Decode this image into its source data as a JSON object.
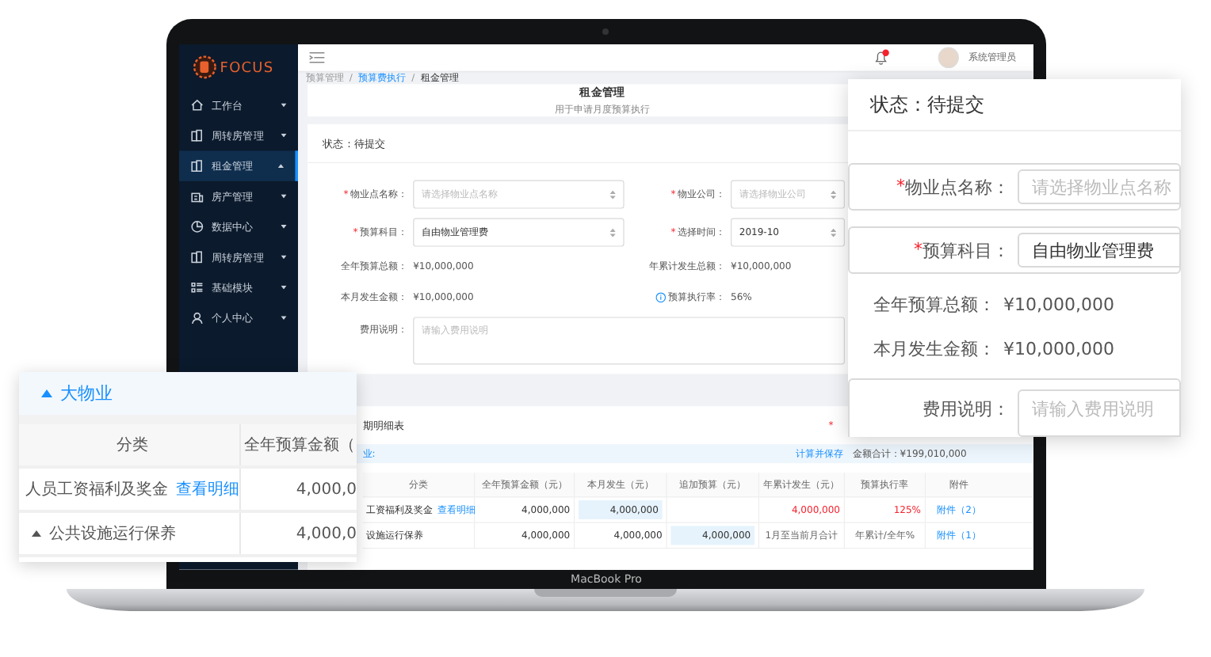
{
  "sidebar": {
    "logo": "FOCUS",
    "items": [
      {
        "label": "工作台",
        "selected": false,
        "expanded": false
      },
      {
        "label": "周转房管理",
        "selected": false,
        "expanded": false
      },
      {
        "label": "租金管理",
        "selected": true,
        "expanded": true
      },
      {
        "label": "房产管理",
        "selected": false,
        "expanded": false
      },
      {
        "label": "数据中心",
        "selected": false,
        "expanded": false
      },
      {
        "label": "周转房管理",
        "selected": false,
        "expanded": false
      },
      {
        "label": "基础模块",
        "selected": false,
        "expanded": false
      },
      {
        "label": "个人中心",
        "selected": false,
        "expanded": false
      }
    ]
  },
  "topbar": {
    "user": "系统管理员"
  },
  "breadcrumb": {
    "separator": "/",
    "items": [
      {
        "label": "预算管理",
        "kind": "parent"
      },
      {
        "label": "预算费执行",
        "kind": "link"
      },
      {
        "label": "租金管理",
        "kind": "current"
      }
    ]
  },
  "page_header": {
    "title": "租金管理",
    "subtitle": "用于申请月度预算执行"
  },
  "status": "状态：待提交",
  "form": {
    "fields": [
      {
        "kind": "select",
        "label": "物业点名称：",
        "required": true,
        "placeholder": "请选择物业点名称"
      },
      {
        "kind": "select",
        "label": "物业公司：",
        "required": true,
        "placeholder": "请选择物业公司"
      },
      {
        "kind": "select",
        "label": "预算科目：",
        "required": true,
        "value": "自由物业管理费"
      },
      {
        "kind": "select",
        "label": "选择时间：",
        "required": true,
        "value": "2019-10"
      },
      {
        "kind": "text",
        "label": "全年预算总额：",
        "required": false,
        "value": "¥10,000,000"
      },
      {
        "kind": "text",
        "label": "年累计发生总额：",
        "required": false,
        "value": "¥10,000,000"
      },
      {
        "kind": "text",
        "label": "本月发生金额：",
        "required": false,
        "value": "¥10,000,000"
      },
      {
        "kind": "info",
        "label": "预算执行率：",
        "required": false,
        "value": "56%"
      },
      {
        "kind": "textarea",
        "label": "费用说明：",
        "required": false,
        "placeholder": "请输入费用说明"
      }
    ]
  },
  "detail": {
    "title": "期明细表",
    "mark": "*",
    "group": "业:",
    "save_link": "计算并保存",
    "total": "金额合计：¥199,010,000",
    "columns": [
      "分类",
      "全年预算金额（元）",
      "本月发生（元）",
      "追加预算（元）",
      "年累计发生（元）",
      "预算执行率",
      "附件"
    ],
    "rows": [
      {
        "cells": [
          {
            "kind": "label",
            "text": "工资福利及奖金",
            "link": "查看明细"
          },
          {
            "kind": "plain",
            "text": "4,000,000"
          },
          {
            "kind": "input",
            "text": "4,000,000"
          },
          {
            "kind": "empty"
          },
          {
            "kind": "alert",
            "text": "4,000,000"
          },
          {
            "kind": "alert",
            "text": "125%"
          },
          {
            "kind": "link",
            "text": "附件（2）"
          }
        ]
      },
      {
        "cells": [
          {
            "kind": "label",
            "text": "设施运行保养"
          },
          {
            "kind": "plain",
            "text": "4,000,000"
          },
          {
            "kind": "plain",
            "text": "4,000,000"
          },
          {
            "kind": "input",
            "text": "4,000,000"
          },
          {
            "kind": "note",
            "text": "1月至当前月合计"
          },
          {
            "kind": "note",
            "text": "年累计/全年%"
          },
          {
            "kind": "link",
            "text": "附件（1）"
          }
        ]
      }
    ]
  },
  "device_label": "MacBook Pro",
  "left_card": {
    "group": "大物业",
    "expanded": true,
    "columns": [
      "分类",
      "全年预算金额（"
    ],
    "rows": [
      {
        "kind": "leaf",
        "label": "人员工资福利及奖金",
        "link": "查看明细",
        "amount": "4,000,0"
      },
      {
        "kind": "group",
        "label": "公共设施运行保养",
        "amount": "4,000,0",
        "expanded": true
      }
    ]
  },
  "right_card": {
    "status": "状态：待提交",
    "fields": [
      {
        "kind": "select",
        "label": "物业点名称：",
        "required": true,
        "placeholder": "请选择物业点名称"
      },
      {
        "kind": "select",
        "label": "预算科目：",
        "required": true,
        "value": "自由物业管理费"
      },
      {
        "kind": "text",
        "label": "全年预算总额：",
        "required": false,
        "value": "¥10,000,000"
      },
      {
        "kind": "text",
        "label": "本月发生金额：",
        "required": false,
        "value": "¥10,000,000"
      },
      {
        "kind": "textarea",
        "label": "费用说明：",
        "required": false,
        "placeholder": "请输入费用说明"
      }
    ]
  }
}
